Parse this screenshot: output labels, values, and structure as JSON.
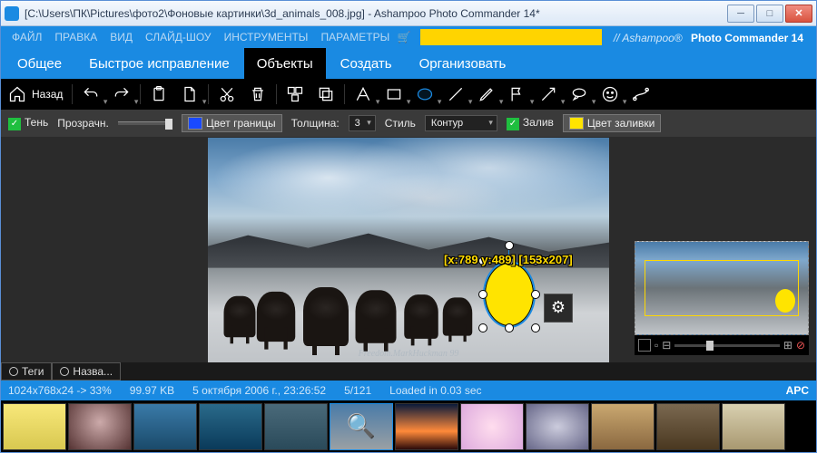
{
  "titlebar": {
    "title": "[C:\\Users\\ПК\\Pictures\\фото2\\Фоновые картинки\\3d_animals_008.jpg] - Ashampoo Photo Commander 14*"
  },
  "menu": {
    "items": [
      "ФАЙЛ",
      "ПРАВКА",
      "ВИД",
      "СЛАЙД-ШОУ",
      "ИНСТРУМЕНТЫ",
      "ПАРАМЕТРЫ"
    ],
    "brand_prefix": "// Ashampoo®",
    "brand_main": " Photo Commander 14"
  },
  "maintabs": {
    "items": [
      "Общее",
      "Быстрое исправление",
      "Объекты",
      "Создать",
      "Организовать"
    ],
    "active_index": 2
  },
  "toolbar": {
    "back": "Назад"
  },
  "propbar": {
    "shadow_label": "Тень",
    "opacity_label": "Прозрачн.",
    "border_color_label": "Цвет границы",
    "border_color": "#1a4aff",
    "thickness_label": "Толщина:",
    "thickness_value": "3",
    "style_label": "Стиль",
    "style_value": "Контур",
    "fill_check_label": "Залив",
    "fill_color_label": "Цвет заливки",
    "fill_color": "#ffe400"
  },
  "canvas": {
    "watermark": "Freedom.MarkHuckman 99",
    "coord": "[x:789 y:489] [153x207]"
  },
  "bottom_tags": {
    "t1": "Теги",
    "t2": "Назва..."
  },
  "status": {
    "dims": "1024x768x24 -> 33%",
    "size": "99.97 KB",
    "date": "5 октября 2006 г., 23:26:52",
    "index": "5/121",
    "loaded": "Loaded in 0.03 sec",
    "mode": "APC"
  },
  "thumbs": {
    "gradients": [
      "linear-gradient(#f8e87a,#d8c850)",
      "radial-gradient(circle at 50% 40%,#caa,#533)",
      "linear-gradient(#3a7aa8,#1a4a6a)",
      "linear-gradient(#2a6a8a,#0a3a5a)",
      "linear-gradient(#4a6a7a,#2a4a5a)",
      "",
      "linear-gradient(180deg,#0a1a3a,#ff8a3a 60%,#2a0a0a)",
      "radial-gradient(circle,#fde,#dad)",
      "radial-gradient(ellipse,#ccd,#668)",
      "linear-gradient(#caa870,#8a6840)",
      "linear-gradient(#7a6850,#4a3820)",
      "linear-gradient(#d8d0b0,#a89870)"
    ],
    "active_index": 5
  }
}
